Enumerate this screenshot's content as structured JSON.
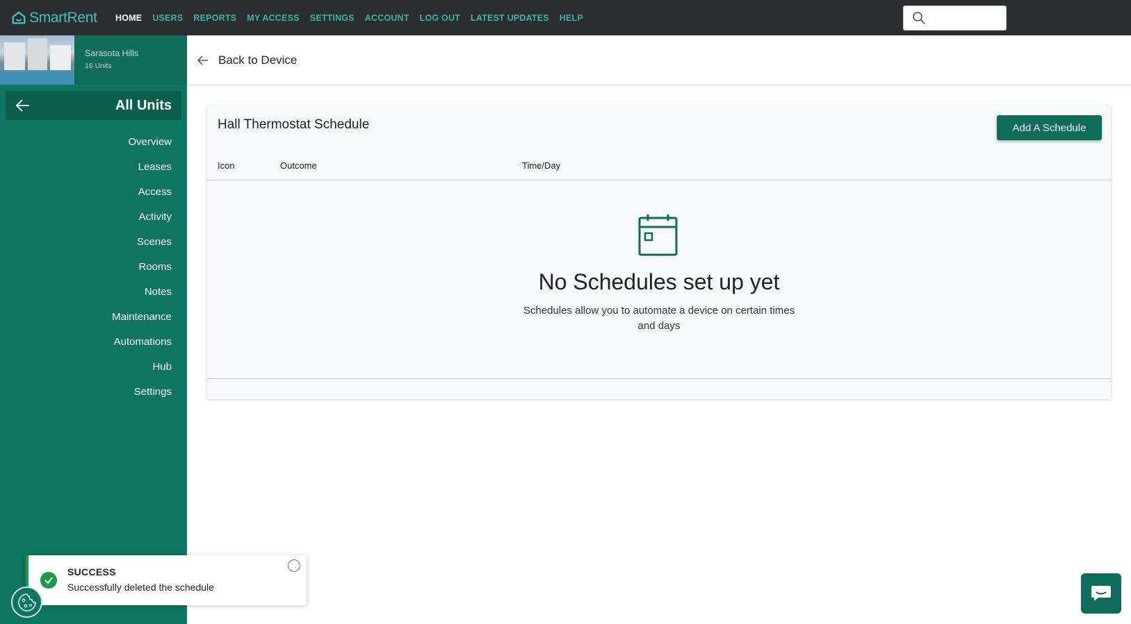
{
  "brand": {
    "name": "SmartRent",
    "accent": "#3bc4b7",
    "primary": "#0e7560"
  },
  "topnav": {
    "items": [
      {
        "label": "HOME",
        "active": true
      },
      {
        "label": "USERS"
      },
      {
        "label": "REPORTS"
      },
      {
        "label": "MY ACCESS"
      },
      {
        "label": "SETTINGS"
      },
      {
        "label": "ACCOUNT"
      },
      {
        "label": "LOG OUT"
      },
      {
        "label": "LATEST UPDATES"
      },
      {
        "label": "HELP"
      }
    ],
    "search_icon": "search-icon",
    "search_placeholder": ""
  },
  "property": {
    "name": "Sarasota Hills",
    "units": "16 Units"
  },
  "sidebar": {
    "all_units_label": "All Units",
    "items": [
      {
        "label": "Overview"
      },
      {
        "label": "Leases"
      },
      {
        "label": "Access"
      },
      {
        "label": "Activity"
      },
      {
        "label": "Scenes"
      },
      {
        "label": "Rooms"
      },
      {
        "label": "Notes"
      },
      {
        "label": "Maintenance"
      },
      {
        "label": "Automations"
      },
      {
        "label": "Hub"
      },
      {
        "label": "Settings"
      }
    ]
  },
  "subheader": {
    "back_label": "Back to Device"
  },
  "schedule": {
    "title": "Hall Thermostat Schedule",
    "add_button": "Add A Schedule",
    "columns": [
      "Icon",
      "Outcome",
      "Time/Day"
    ],
    "empty_title": "No Schedules set up yet",
    "empty_description": "Schedules allow you to automate a device on certain times and days"
  },
  "toast": {
    "title": "SUCCESS",
    "message": "Successfully deleted the schedule",
    "status_color": "#1a9a4b"
  }
}
